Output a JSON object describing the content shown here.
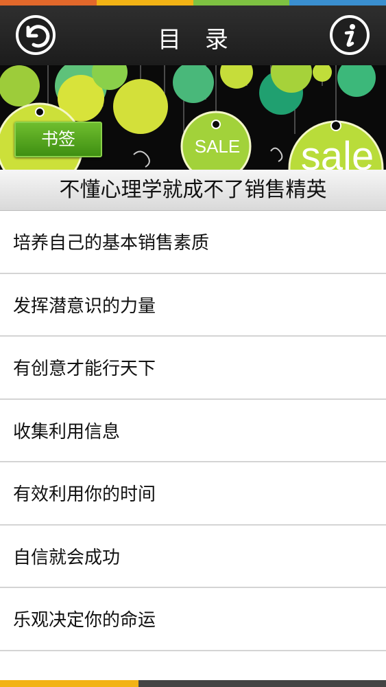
{
  "header": {
    "title": "目 录",
    "back_icon": "back-arrow-icon",
    "info_icon": "info-icon"
  },
  "banner": {
    "bookmark_label": "书签",
    "sale_tag_small": "SALE",
    "sale_tag_large": "sale"
  },
  "book": {
    "title": "不懂心理学就成不了销售精英"
  },
  "chapters": [
    "培养自己的基本销售素质",
    "发挥潜意识的力量",
    "有创意才能行天下",
    "收集利用信息",
    "有效利用你的时间",
    "自信就会成功",
    "乐观决定你的命运"
  ],
  "colors": {
    "header_bg": "#1f1f1f",
    "stripe": [
      "#e2682b",
      "#f2b315",
      "#7ec242",
      "#3a8fd0"
    ],
    "bookmark_green": "#4f9f1a",
    "divider": "#d4d4d4"
  }
}
